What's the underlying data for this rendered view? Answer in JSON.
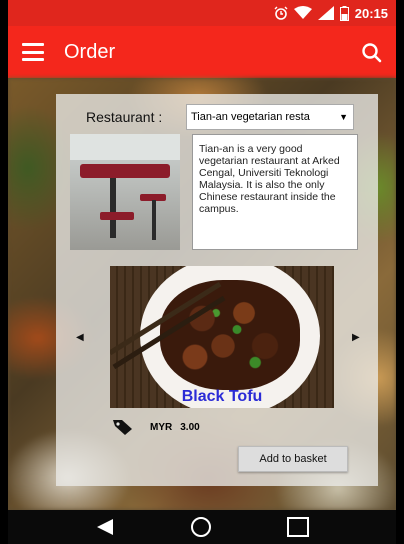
{
  "status_bar": {
    "time": "20:15",
    "icons": [
      "alarm-icon",
      "wifi-icon",
      "signal-icon",
      "battery-icon"
    ]
  },
  "app_bar": {
    "title": "Order",
    "menu_icon": "menu-icon",
    "search_icon": "search-icon"
  },
  "form": {
    "restaurant_label": "Restaurant :",
    "restaurant_selected": "Tian-an vegetarian resta"
  },
  "restaurant": {
    "description": "Tian-an is a very good vegetarian restaurant at Arked Cengal, Universiti Teknologi Malaysia. It is also the only Chinese restaurant inside the campus."
  },
  "dish": {
    "name": "Black Tofu",
    "currency": "MYR",
    "price": "3.00"
  },
  "actions": {
    "add_to_basket": "Add to basket"
  },
  "colors": {
    "app_bar": "#f4271c",
    "status_bar": "#e0261d",
    "dish_name": "#2b2bd6"
  }
}
